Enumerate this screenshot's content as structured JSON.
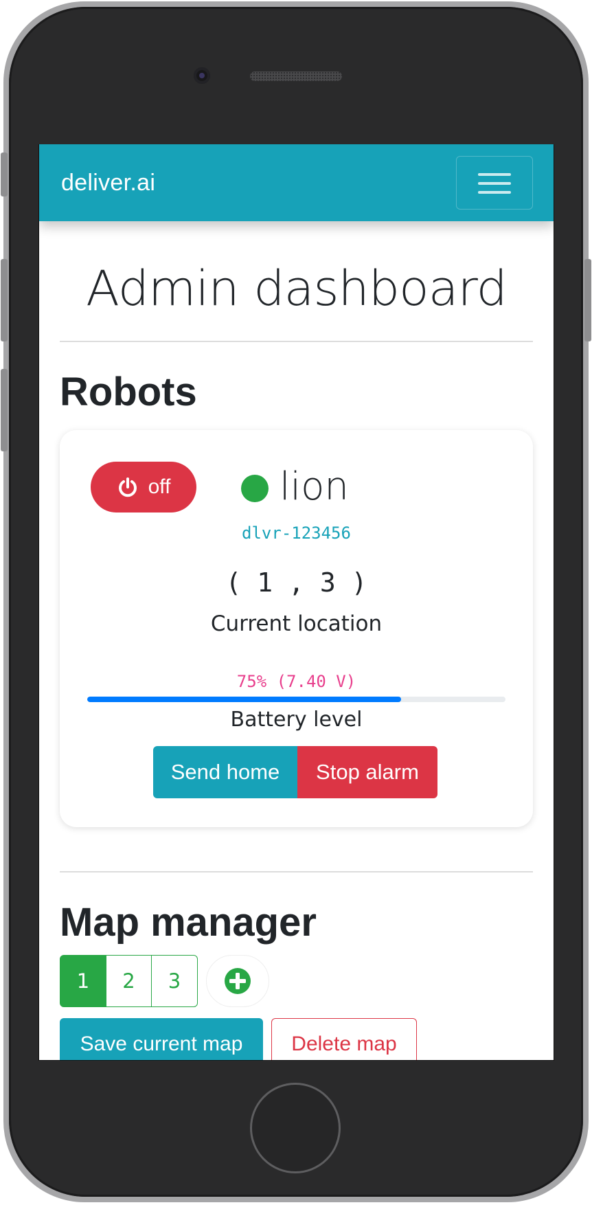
{
  "navbar": {
    "brand": "deliver.ai",
    "menu_icon": "hamburger-icon"
  },
  "page": {
    "title": "Admin dashboard"
  },
  "robots": {
    "section_title": "Robots",
    "items": [
      {
        "power_label": "off",
        "power_icon": "power-icon",
        "status_color": "#28a745",
        "name": "lion",
        "id": "dlvr-123456",
        "location": "( 1 , 3 )",
        "location_label": "Current location",
        "battery_text": "75% (7.40 V)",
        "battery_percent": 75,
        "battery_label": "Battery level",
        "send_home_label": "Send home",
        "stop_alarm_label": "Stop alarm"
      }
    ]
  },
  "map_manager": {
    "title": "Map manager",
    "pages": [
      "1",
      "2",
      "3"
    ],
    "active_page": "1",
    "add_icon": "plus-circle-icon",
    "save_label": "Save current map",
    "delete_label": "Delete map"
  },
  "colors": {
    "primary": "#17a2b8",
    "danger": "#dc3545",
    "success": "#28a745",
    "battery": "#007bff",
    "code": "#e83e8c"
  }
}
